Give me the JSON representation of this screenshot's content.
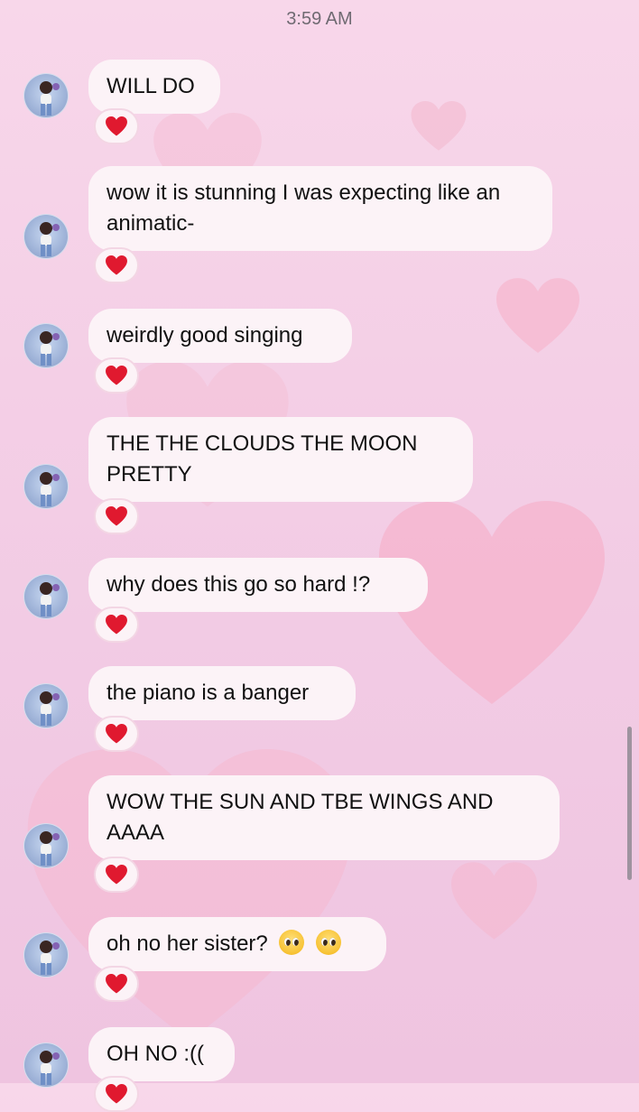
{
  "timestamp": "3:59 AM",
  "colors": {
    "bubble": "#fcf3f7",
    "reaction": "#e0192f",
    "background": "#f4cfe6"
  },
  "reaction_icon": "red-heart-icon",
  "messages": [
    {
      "text": "WILL DO",
      "reaction": "heart"
    },
    {
      "text": "wow it is stunning I was expecting like an animatic-",
      "reaction": "heart"
    },
    {
      "text": "weirdly good singing",
      "reaction": "heart"
    },
    {
      "text": "THE THE CLOUDS THE MOON PRETTY",
      "reaction": "heart"
    },
    {
      "text": "why does this go so hard !?",
      "reaction": "heart"
    },
    {
      "text": "the piano is a banger",
      "reaction": "heart"
    },
    {
      "text": "WOW THE SUN AND TBE WINGS AND AAAA",
      "reaction": "heart"
    },
    {
      "text": "oh no her sister?",
      "emojis": [
        "pleading-face-emoji",
        "pleading-face-emoji"
      ],
      "reaction": "heart"
    },
    {
      "text": "OH NO :((",
      "reaction": "heart"
    }
  ]
}
